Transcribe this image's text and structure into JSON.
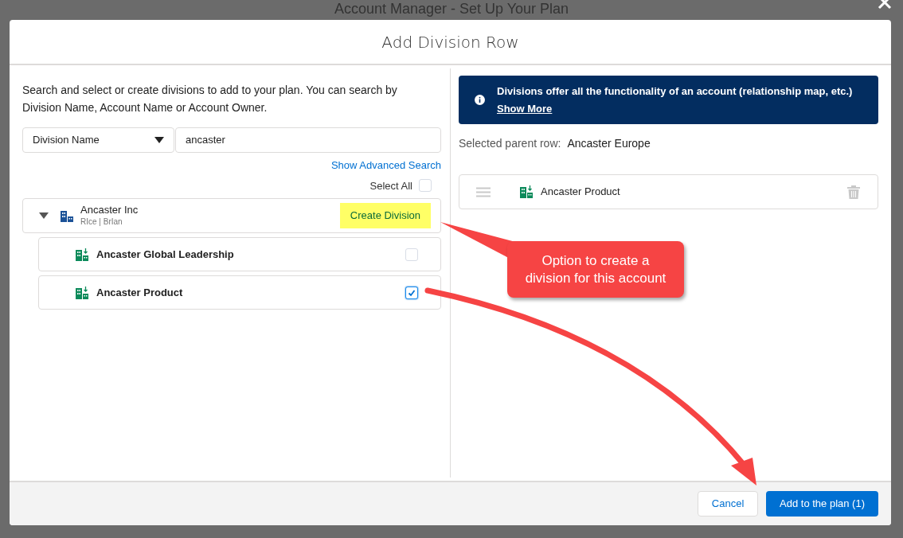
{
  "backdrop_title": "Account Manager - Set Up Your Plan",
  "dialog": {
    "title": "Add Division Row"
  },
  "search_panel": {
    "instructions": "Search and select or create divisions to add to your plan. You can search by Division Name, Account Name or Account Owner.",
    "search_by": "Division Name",
    "search": {
      "value": "ancaster"
    },
    "advanced_link": "Show Advanced Search",
    "select_all": {
      "label": "Select All",
      "checked": false
    },
    "account": {
      "name": "Ancaster Inc",
      "owner": "RIce | BrIan",
      "expanded": true,
      "create_button": "Create Division",
      "children": [
        {
          "name": "Ancaster Global Leadership",
          "checked": false
        },
        {
          "name": "Ancaster Product",
          "checked": true
        }
      ]
    }
  },
  "selection_panel": {
    "banner": {
      "text": "Divisions offer all the functionality of an account (relationship map, etc.)",
      "link": "Show More"
    },
    "parent_label": "Selected parent row:",
    "parent_value": "Ancaster Europe",
    "selected_rows": [
      {
        "name": "Ancaster Product"
      }
    ]
  },
  "callout": {
    "text": "Option to create a division for this account"
  },
  "footer": {
    "cancel": "Cancel",
    "submit": "Add to the plan (1)"
  }
}
